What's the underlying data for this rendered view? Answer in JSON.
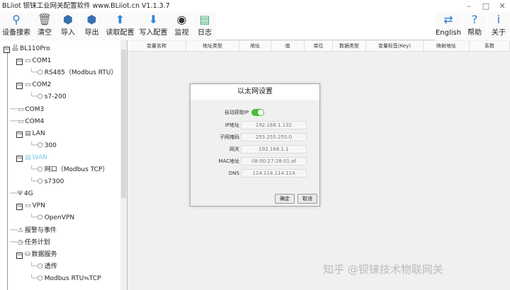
{
  "window": {
    "title": "BLiiot  钡铼工业网关配置软件 www.BLiiot.cn V1.1.3.7",
    "minimize": "–",
    "maximize": "□",
    "close": "✕"
  },
  "toolbar": {
    "left": [
      {
        "label": "设备搜索",
        "icon": "search-icon",
        "glyph": "⚲"
      },
      {
        "label": "清空",
        "icon": "brush-icon",
        "glyph": "🗑"
      },
      {
        "label": "导入",
        "icon": "import-icon",
        "glyph": "⬢"
      },
      {
        "label": "导出",
        "icon": "export-icon",
        "glyph": "⬢"
      },
      {
        "label": "读取配置",
        "icon": "read-config-icon",
        "glyph": "⬆"
      },
      {
        "label": "写入配置",
        "icon": "write-config-icon",
        "glyph": "⬇"
      },
      {
        "label": "监视",
        "icon": "eye-icon",
        "glyph": "◉"
      },
      {
        "label": "日志",
        "icon": "log-icon",
        "glyph": "▤"
      }
    ],
    "right": [
      {
        "label": "English",
        "icon": "language-icon",
        "glyph": "⇄"
      },
      {
        "label": "帮助",
        "icon": "help-icon",
        "glyph": "?"
      },
      {
        "label": "关于",
        "icon": "info-icon",
        "glyph": "i"
      }
    ]
  },
  "tree": [
    {
      "label": "BL110Pro",
      "level": 0,
      "expander": true,
      "glyph": "品"
    },
    {
      "label": "COM1",
      "level": 1,
      "expander": true,
      "glyph": "▭"
    },
    {
      "label": "RS485（Modbus RTU）",
      "level": 2,
      "glyph": "⬡"
    },
    {
      "label": "COM2",
      "level": 1,
      "expander": true,
      "glyph": "▭"
    },
    {
      "label": "s7-200",
      "level": 2,
      "glyph": "⬡"
    },
    {
      "label": "COM3",
      "level": 1,
      "glyph": "▭"
    },
    {
      "label": "COM4",
      "level": 1,
      "glyph": "▭"
    },
    {
      "label": "LAN",
      "level": 1,
      "expander": true,
      "glyph": "▤"
    },
    {
      "label": "300",
      "level": 2,
      "glyph": "⬡"
    },
    {
      "label": "WAN",
      "level": 1,
      "expander": true,
      "glyph": "▤",
      "selected": true
    },
    {
      "label": "网口（Modbus TCP）",
      "level": 2,
      "glyph": "⬡"
    },
    {
      "label": "s7300",
      "level": 2,
      "glyph": "⬡"
    },
    {
      "label": "4G",
      "level": 1,
      "glyph": "Ψ"
    },
    {
      "label": "VPN",
      "level": 1,
      "expander": true,
      "glyph": "▭"
    },
    {
      "label": "OpenVPN",
      "level": 2,
      "glyph": "⬡"
    },
    {
      "label": "报警与事件",
      "level": 1,
      "glyph": "⚠"
    },
    {
      "label": "任务计划",
      "level": 1,
      "glyph": "◷"
    },
    {
      "label": "数据服务",
      "level": 1,
      "expander": true,
      "glyph": "⛁"
    },
    {
      "label": "透传",
      "level": 2,
      "glyph": "⬡"
    },
    {
      "label": "Modbus RTU≒TCP",
      "level": 2,
      "glyph": "⬡"
    }
  ],
  "table": {
    "columns": [
      "变量名称",
      "地址类型",
      "地址",
      "值",
      "单位",
      "数据类型",
      "变量标签(Key)",
      "映射地址",
      "系数"
    ]
  },
  "dialog": {
    "title": "以太网设置",
    "auto_ip_label": "自动获取IP",
    "auto_ip": true,
    "fields": [
      {
        "label": "IP地址",
        "value": "192.168.1.132"
      },
      {
        "label": "子网掩码",
        "value": "255.255.255.0"
      },
      {
        "label": "网关",
        "value": "192.168.1.1"
      },
      {
        "label": "MAC地址",
        "value": "08:00:27:28:01:af"
      },
      {
        "label": "DNS",
        "value": "114.114.114.114"
      }
    ],
    "ok": "确定",
    "cancel": "取消"
  },
  "watermark": "知乎 @钡铼技术物联网关",
  "colors": {
    "accent": "#4cbb3a",
    "selected": "#7ec8e3"
  }
}
